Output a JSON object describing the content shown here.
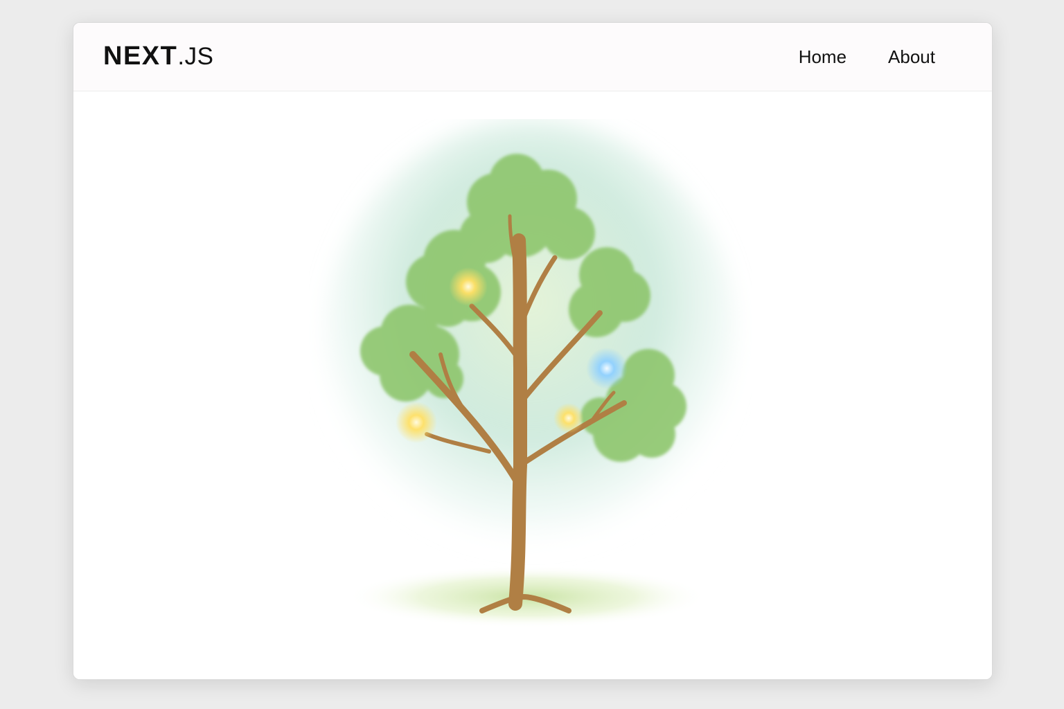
{
  "header": {
    "logo_main": "NEXT",
    "logo_suffix": ".JS",
    "nav": [
      {
        "label": "Home"
      },
      {
        "label": "About"
      }
    ]
  },
  "hero_image": {
    "subject": "tree-illustration",
    "colors": {
      "leaf": "#8cc56a",
      "trunk": "#b07f44",
      "glow_yellow": "#ffe066",
      "glow_blue": "#8fd0ff",
      "halo": "#9ed7cf"
    }
  }
}
